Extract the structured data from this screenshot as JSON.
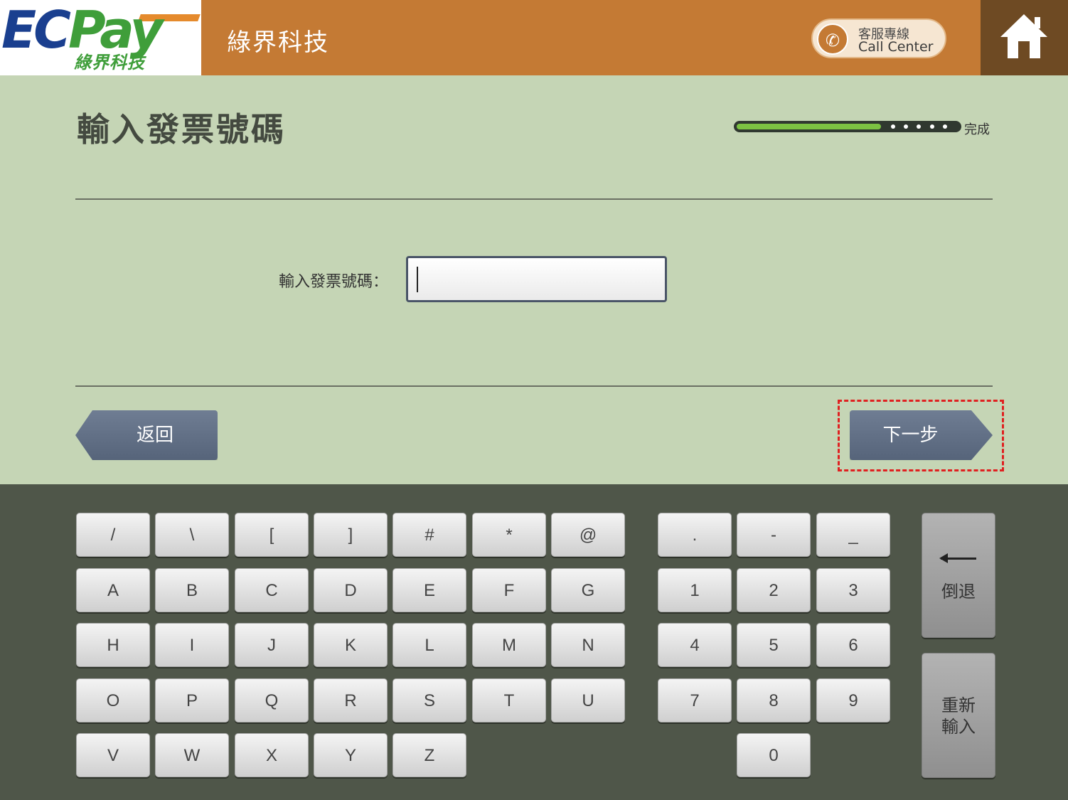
{
  "header": {
    "logo_main_ec": "EC",
    "logo_main_pay": "Pay",
    "logo_sub": "綠界科技",
    "brand_name": "綠界科技",
    "call_center_line1": "客服專線",
    "call_center_line2": "Call Center"
  },
  "page": {
    "title": "輸入發票號碼",
    "progress_label": "完成",
    "progress_fraction": 0.65,
    "progress_remaining_steps": 5,
    "field_label": "輸入發票號碼：",
    "input_value": ""
  },
  "nav": {
    "back_label": "返回",
    "next_label": "下一步"
  },
  "keyboard": {
    "symbols": [
      "/",
      "\\",
      "[",
      "]",
      "#",
      "*",
      "@"
    ],
    "letters": [
      [
        "A",
        "B",
        "C",
        "D",
        "E",
        "F",
        "G"
      ],
      [
        "H",
        "I",
        "J",
        "K",
        "L",
        "M",
        "N"
      ],
      [
        "O",
        "P",
        "Q",
        "R",
        "S",
        "T",
        "U"
      ],
      [
        "V",
        "W",
        "X",
        "Y",
        "Z"
      ]
    ],
    "numpad": [
      [
        ".",
        "-",
        "_"
      ],
      [
        "1",
        "2",
        "3"
      ],
      [
        "4",
        "5",
        "6"
      ],
      [
        "7",
        "8",
        "9"
      ],
      [
        "0"
      ]
    ],
    "backspace_label": "倒退",
    "reset_label": "重新輸入"
  },
  "colors": {
    "brand_orange": "#c47a34",
    "home_brown": "#6e4a23",
    "content_bg": "#c5d5b5",
    "keyboard_bg": "#4f5649",
    "progress_green": "#7cc242",
    "highlight_red": "#e02020"
  }
}
